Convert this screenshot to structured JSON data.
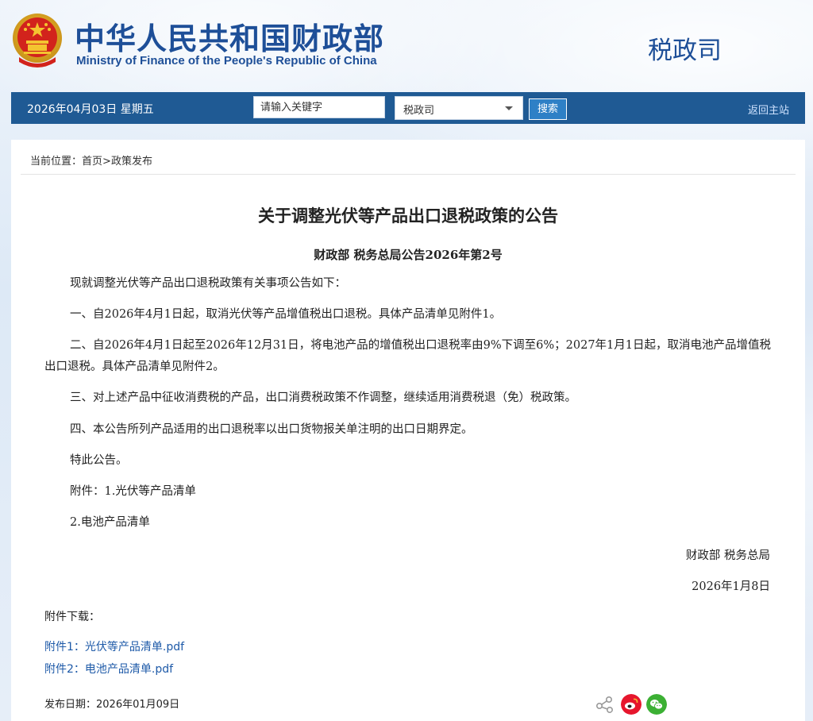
{
  "header": {
    "site_title_cn": "中华人民共和国财政部",
    "site_title_en": "Ministry of Finance of the People's Republic of China",
    "department": "税政司"
  },
  "navbar": {
    "date": "2026年04月03日  星期五",
    "search_placeholder": "请输入关键字",
    "select_value": "税政司",
    "search_button": "搜索",
    "back_home": "返回主站"
  },
  "breadcrumb": {
    "prefix": "当前位置：",
    "home": "首页",
    "separator": ">",
    "current": "政策发布"
  },
  "article": {
    "title": "关于调整光伏等产品出口退税政策的公告",
    "doc_number": "财政部  税务总局公告2026年第2号",
    "paragraphs": [
      "现就调整光伏等产品出口退税政策有关事项公告如下：",
      "一、自2026年4月1日起，取消光伏等产品增值税出口退税。具体产品清单见附件1。",
      "二、自2026年4月1日起至2026年12月31日，将电池产品的增值税出口退税率由9%下调至6%；2027年1月1日起，取消电池产品增值税出口退税。具体产品清单见附件2。",
      "三、对上述产品中征收消费税的产品，出口消费税政策不作调整，继续适用消费税退（免）税政策。",
      "四、本公告所列产品适用的出口退税率以出口货物报关单注明的出口日期界定。",
      "特此公告。",
      "附件：1.光伏等产品清单",
      "2.电池产品清单"
    ],
    "signature": "财政部      税务总局",
    "sign_date": "2026年1月8日"
  },
  "attachments": {
    "title": "附件下载：",
    "links": [
      "附件1：光伏等产品清单.pdf",
      "附件2：电池产品清单.pdf"
    ]
  },
  "publish": {
    "date_text": "发布日期：2026年01月09日"
  },
  "share": {
    "icons": [
      "share-icon",
      "weibo-icon",
      "wechat-icon"
    ]
  },
  "colors": {
    "brand_blue": "#1e4f98",
    "nav_bar": "#1f5a94",
    "search_button": "#2e80c6",
    "link_blue": "#1e5aa8",
    "weibo_red": "#e6162d",
    "wechat_green": "#3cb034"
  }
}
